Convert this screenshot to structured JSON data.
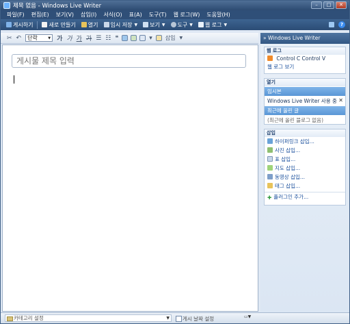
{
  "window": {
    "title": "제목 없음 - Windows Live Writer",
    "min": "–",
    "max": "□",
    "close": "✕"
  },
  "menu": [
    "파일(F)",
    "편집(E)",
    "보기(V)",
    "삽입(I)",
    "서식(O)",
    "표(A)",
    "도구(T)",
    "웹 로그(W)",
    "도움말(H)"
  ],
  "toolbar": {
    "publish": "게시하기",
    "new": "새로 만들기",
    "open": "열기",
    "save_draft": "임시 저장",
    "view": "보기",
    "tools": "도구",
    "weblog": "웹 로그"
  },
  "format": {
    "style": "단락",
    "bold": "가",
    "italic": "가",
    "underline": "가",
    "strike": "가",
    "insert": "삽입"
  },
  "editor": {
    "title_placeholder": "게시물 제목 입력"
  },
  "status": {
    "category": "카테고리 설정",
    "pub_date": "게시 날짜 설정"
  },
  "sidebar": {
    "header": "Windows Live Writer",
    "weblog_panel": {
      "title": "웹 로그",
      "blog_name": "Control C Control V",
      "view_blog": "웹 로그 보기"
    },
    "open_panel": {
      "title": "열기",
      "drafts_header": "임시본",
      "draft_item": "Windows Live Writer 사용 중",
      "recent_header": "최근에 올린 글",
      "recent_item": "(최근에 올린 블로그 없음)"
    },
    "insert_panel": {
      "title": "삽입",
      "items": [
        "하이퍼링크 삽입...",
        "사진 삽입...",
        "표 삽입...",
        "지도 삽입...",
        "동영상 삽입...",
        "태그 삽입..."
      ],
      "add_plugin": "플러그인 추가..."
    }
  },
  "colors": {
    "titlebar": "#2d4b72",
    "toolbar": "#3d6491",
    "sidebar_bg": "#e2ebf6",
    "highlight": "#5a97d6"
  }
}
